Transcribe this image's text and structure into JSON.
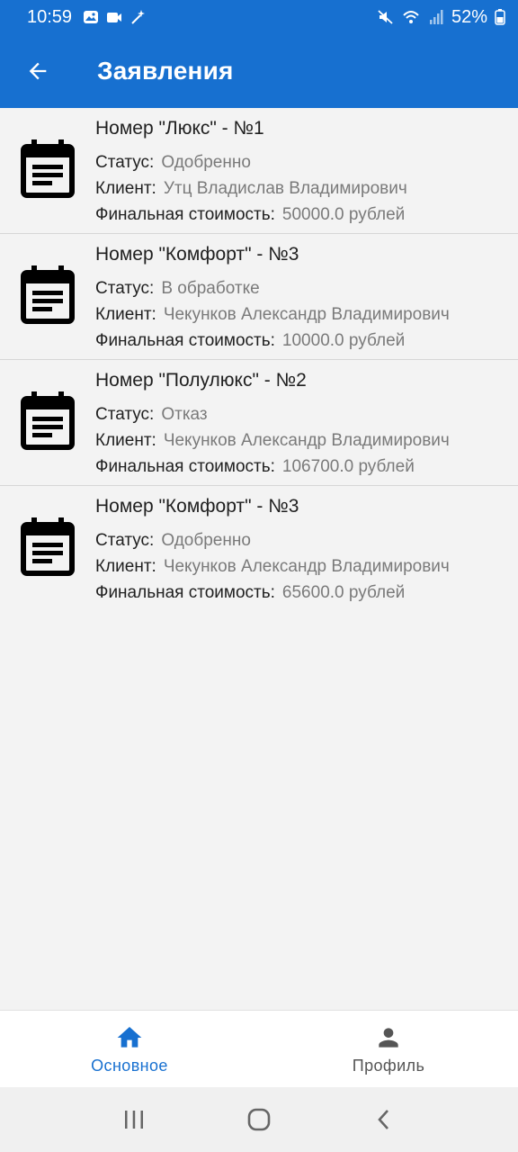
{
  "status_bar": {
    "time": "10:59",
    "battery": "52%",
    "icons": [
      "gallery-icon",
      "video-icon",
      "magic-wand-icon",
      "mute-icon",
      "wifi-icon",
      "signal-icon",
      "battery-icon"
    ]
  },
  "app_bar": {
    "title": "Заявления",
    "back_icon": "arrow-back-icon",
    "color": "#1770d0"
  },
  "applications": [
    {
      "room": "Номер \"Люкс\" - №1",
      "status_label": "Статус:",
      "status": "Одобренно",
      "client_label": "Клиент:",
      "client": "Утц Владислав Владимирович",
      "price_label": "Финальная стоимость:",
      "price": "50000.0 рублей"
    },
    {
      "room": "Номер \"Комфорт\" - №3",
      "status_label": "Статус:",
      "status": "В обработке",
      "client_label": "Клиент:",
      "client": "Чекунков Александр Владимирович",
      "price_label": "Финальная стоимость:",
      "price": "10000.0 рублей"
    },
    {
      "room": "Номер \"Полулюкс\" - №2",
      "status_label": "Статус:",
      "status": "Отказ",
      "client_label": "Клиент:",
      "client": "Чекунков Александр Владимирович",
      "price_label": "Финальная стоимость:",
      "price": "106700.0 рублей"
    },
    {
      "room": "Номер \"Комфорт\" - №3",
      "status_label": "Статус:",
      "status": "Одобренно",
      "client_label": "Клиент:",
      "client": "Чекунков Александр Владимирович",
      "price_label": "Финальная стоимость:",
      "price": "65600.0 рублей"
    }
  ],
  "bottom_nav": {
    "tabs": [
      {
        "label": "Основное",
        "icon": "home-icon",
        "active": true,
        "color": "#1770d0"
      },
      {
        "label": "Профиль",
        "icon": "person-icon",
        "active": false,
        "color": "#555555"
      }
    ]
  },
  "system_nav": {
    "buttons": [
      "recent-apps-icon",
      "home-circle-icon",
      "back-chevron-icon"
    ]
  }
}
